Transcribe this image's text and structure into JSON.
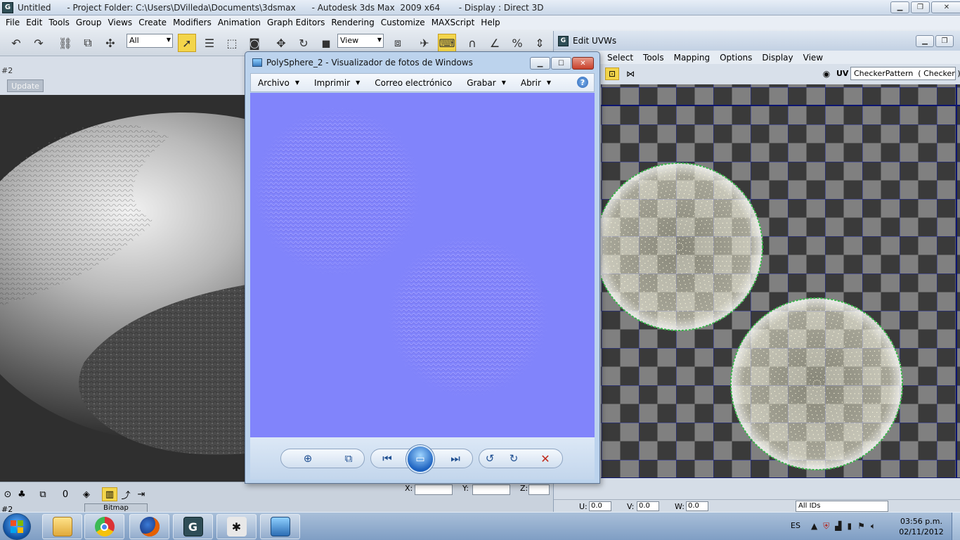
{
  "max": {
    "title": "Untitled      - Project Folder: C:\\Users\\DVilleda\\Documents\\3dsmax      - Autodesk 3ds Max  2009 x64       - Display : Direct 3D",
    "menu": [
      "File",
      "Edit",
      "Tools",
      "Group",
      "Views",
      "Create",
      "Modifiers",
      "Animation",
      "Graph Editors",
      "Rendering",
      "Customize",
      "MAXScript",
      "Help"
    ],
    "toolbar": {
      "filter_select": "All",
      "view_select": "View"
    },
    "left_panel": {
      "number": "#2",
      "update_button": "Update"
    },
    "bottom": {
      "x_label": "X:",
      "y_label": "Y:",
      "z_label": "Z:",
      "material_slot": "#2",
      "bitmap_button": "Bitmap"
    }
  },
  "uvw": {
    "title": "Edit UVWs",
    "menu": [
      "Select",
      "Tools",
      "Mapping",
      "Options",
      "Display",
      "View"
    ],
    "uv_label": "UV",
    "checker_field": "CheckerPattern  ( Checker )",
    "status": {
      "u_label": "U:",
      "v_label": "V:",
      "w_label": "W:",
      "u_value": "0.0",
      "v_value": "0.0",
      "w_value": "0.0",
      "ids_select": "All IDs"
    }
  },
  "photo_viewer": {
    "title": "PolySphere_2 - Visualizador de fotos de Windows",
    "menu": [
      "Archivo",
      "Imprimir",
      "Correo electrónico",
      "Grabar",
      "Abrir"
    ],
    "menu_has_arrow": [
      true,
      true,
      false,
      true,
      true
    ],
    "help": "?"
  },
  "taskbar": {
    "lang": "ES",
    "time": "03:56 p.m.",
    "date": "02/11/2012"
  },
  "colors": {
    "normal_map_bg": "#8184fb",
    "uv_seam": "#2a7a2a",
    "uv_point": "#fffbe0",
    "checker_dark": "#3a3a3a",
    "checker_light": "#808080",
    "uv_grid": "#1e2a9e"
  }
}
